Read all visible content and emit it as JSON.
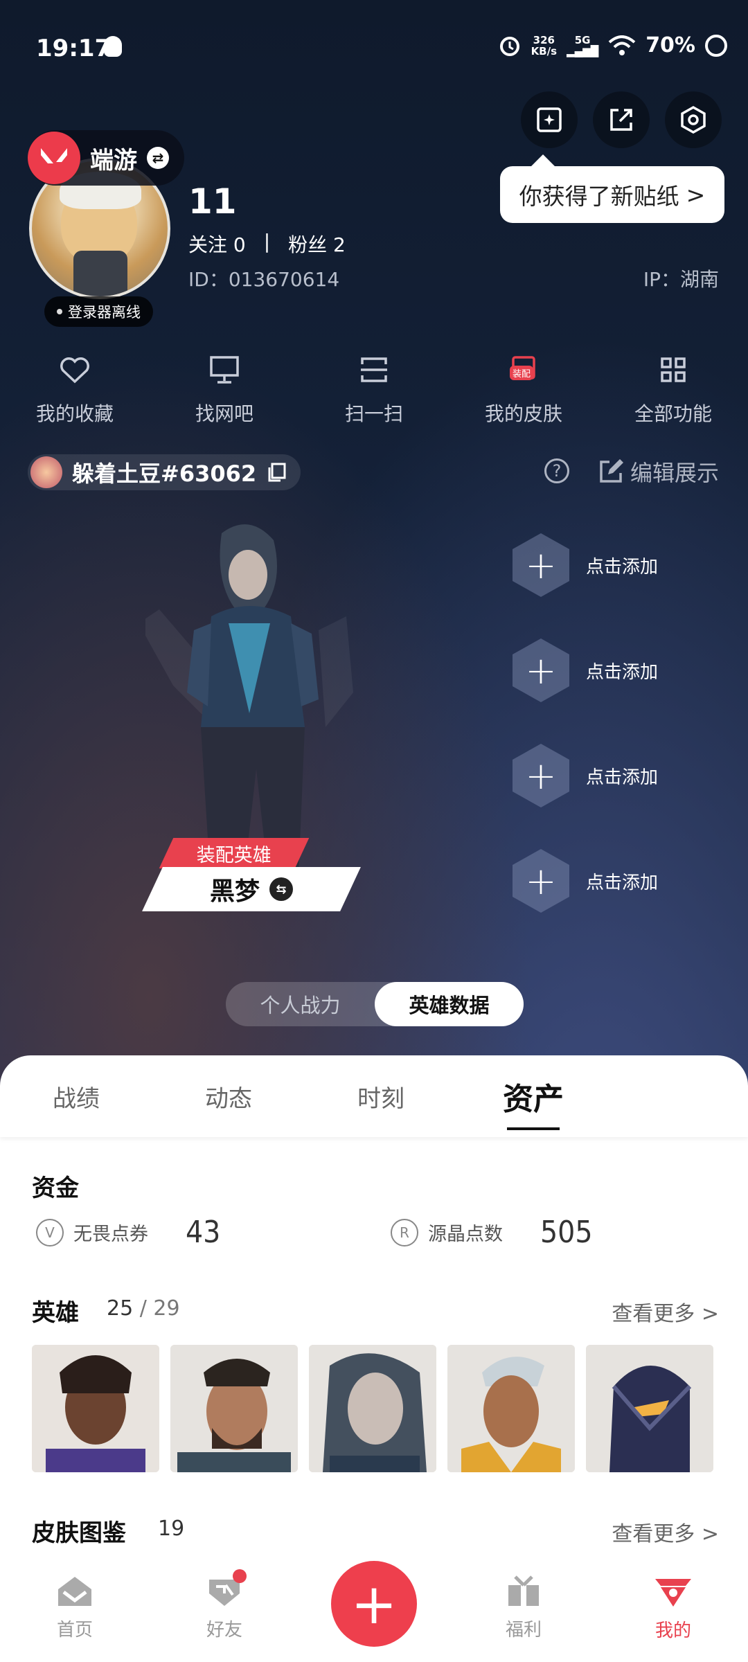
{
  "status": {
    "time": "19:17",
    "speed_value": "326",
    "speed_unit": "KB/s",
    "net": "5G",
    "battery": "70%"
  },
  "tooltip": {
    "text": "你获得了新贴纸",
    "chevron": ">"
  },
  "game": {
    "name": "端游"
  },
  "profile": {
    "offline": "登录器离线",
    "name": "11",
    "follow": "关注 0",
    "separator": "|",
    "fans": "粉丝 2",
    "id": "ID：013670614",
    "ip": "IP：湖南"
  },
  "functions": [
    {
      "label": "我的收藏",
      "icon": "heart-icon"
    },
    {
      "label": "找网吧",
      "icon": "monitor-icon"
    },
    {
      "label": "扫一扫",
      "icon": "scan-icon"
    },
    {
      "label": "我的皮肤",
      "icon": "skin-icon",
      "tag": "装配"
    },
    {
      "label": "全部功能",
      "icon": "grid-icon"
    }
  ],
  "game_account": {
    "name": "躲着土豆#63062"
  },
  "edit_display": "编辑展示",
  "hero": {
    "tag": "装配英雄",
    "name": "黑梦"
  },
  "slots": [
    "点击添加",
    "点击添加",
    "点击添加",
    "点击添加"
  ],
  "toggle": [
    "个人战力",
    "英雄数据"
  ],
  "tabs": [
    "战绩",
    "动态",
    "时刻",
    "资产"
  ],
  "funds": {
    "title": "资金",
    "vp": {
      "label": "无畏点券",
      "value": "43"
    },
    "rp": {
      "label": "源晶点数",
      "value": "505"
    }
  },
  "heroes_section": {
    "title": "英雄",
    "count": "25",
    "total": "/ 29",
    "more": "查看更多 >"
  },
  "skins_section": {
    "title": "皮肤图鉴",
    "count": "19",
    "more": "查看更多 >"
  },
  "nav": [
    "首页",
    "好友",
    "",
    "福利",
    "我的"
  ],
  "colors": {
    "accent": "#e8414e"
  }
}
